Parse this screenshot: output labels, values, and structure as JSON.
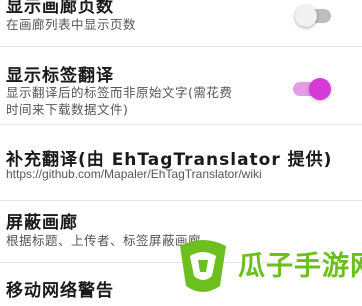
{
  "settings": [
    {
      "title": "显示画廊页数",
      "subtitle": "在画廊列表中显示页数",
      "toggle": "off"
    },
    {
      "title": "显示标签翻译",
      "subtitle_line1": "显示翻译后的标签而非原始文字(需花费",
      "subtitle_line2": "时间来下载数据文件)",
      "toggle": "on"
    },
    {
      "title": "补充翻译(由 EhTagTranslator 提供)",
      "subtitle": "https://github.com/Mapaler/EhTagTranslator/wiki"
    },
    {
      "title": "屏蔽画廊",
      "subtitle": "根据标题、上传者、标签屏蔽画廊"
    },
    {
      "title": "移动网络警告"
    }
  ],
  "watermark": {
    "text": "瓜子手游网"
  },
  "colors": {
    "accent": "#d63ad6",
    "accent_track": "#e79be7",
    "watermark": "#6cbf1e"
  }
}
